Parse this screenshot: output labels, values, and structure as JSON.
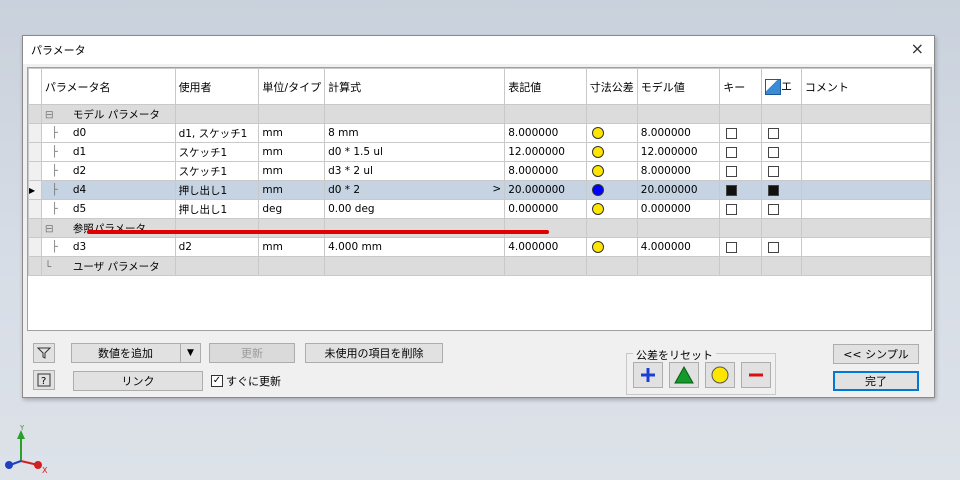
{
  "dialog": {
    "title": "パラメータ",
    "close_glyph": "×"
  },
  "columns": [
    "パラメータ名",
    "使用者",
    "単位/タイプ",
    "計算式",
    "表記値",
    "寸法公差",
    "モデル値",
    "キー",
    "エ",
    "コメント"
  ],
  "groups": {
    "model": "モデル パラメータ",
    "ref": "参照パラメータ",
    "user": "ユーザ パラメータ"
  },
  "rows": [
    {
      "name": "d0",
      "user": "d1, スケッチ1",
      "unit": "mm",
      "expr": "8 mm",
      "nominal": "8.000000",
      "model": "8.000000",
      "tol_color": "#ffe600",
      "key": false,
      "export": false
    },
    {
      "name": "d1",
      "user": "スケッチ1",
      "unit": "mm",
      "expr": "d0 * 1.5 ul",
      "nominal": "12.000000",
      "model": "12.000000",
      "tol_color": "#ffe600",
      "key": false,
      "export": false
    },
    {
      "name": "d2",
      "user": "スケッチ1",
      "unit": "mm",
      "expr": "d3 * 2 ul",
      "nominal": "8.000000",
      "model": "8.000000",
      "tol_color": "#ffe600",
      "key": false,
      "export": false
    },
    {
      "name": "d4",
      "user": "押し出し1",
      "unit": "mm",
      "expr": "d0 * 2",
      "nominal": "20.000000",
      "model": "20.000000",
      "tol_color": "#0000ff",
      "key": true,
      "export": true,
      "expr_arrow": ">"
    },
    {
      "name": "d5",
      "user": "押し出し1",
      "unit": "deg",
      "expr": "0.00 deg",
      "nominal": "0.000000",
      "model": "0.000000",
      "tol_color": "#ffe600",
      "key": false,
      "export": false
    },
    {
      "name": "d3",
      "user": "d2",
      "unit": "mm",
      "expr": "4.000 mm",
      "nominal": "4.000000",
      "model": "4.000000",
      "tol_color": "#ffe600",
      "key": false,
      "export": false
    }
  ],
  "row_pointer": "▶",
  "footer": {
    "add_number": "数値を追加",
    "update": "更新",
    "remove_unused": "未使用の項目を削除",
    "link": "リンク",
    "immediate_update": "すぐに更新",
    "reset_tolerance": "公差をリセット",
    "simple": "<< シンプル",
    "done": "完了"
  },
  "colors": {
    "accent": "#0078d7",
    "highlight_row": "#c5d3e2",
    "red_mark": "#e00000"
  },
  "axis": {
    "y": "Y",
    "x": "X"
  }
}
